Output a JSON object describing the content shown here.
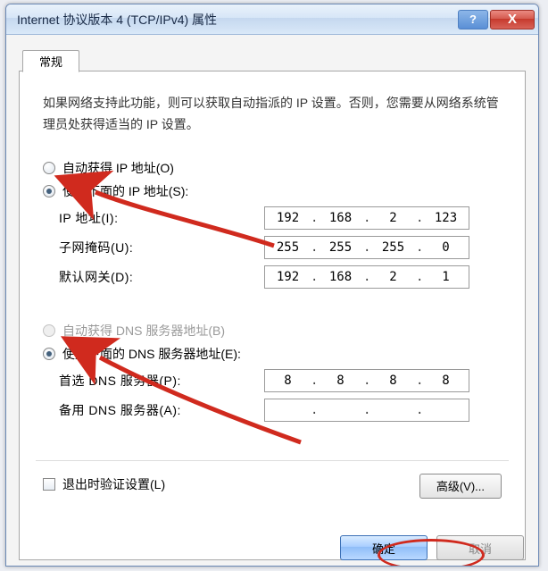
{
  "titlebar": {
    "title": "Internet 协议版本 4 (TCP/IPv4) 属性",
    "help": "?",
    "close": "X"
  },
  "tab_general": "常规",
  "description": "如果网络支持此功能，则可以获取自动指派的 IP 设置。否则，您需要从网络系统管理员处获得适当的 IP 设置。",
  "ip_section": {
    "auto_label": "自动获得 IP 地址(O)",
    "manual_label": "使用下面的 IP 地址(S):",
    "ip_label": "IP 地址(I):",
    "ip": [
      "192",
      "168",
      "2",
      "123"
    ],
    "mask_label": "子网掩码(U):",
    "mask": [
      "255",
      "255",
      "255",
      "0"
    ],
    "gw_label": "默认网关(D):",
    "gw": [
      "192",
      "168",
      "2",
      "1"
    ]
  },
  "dns_section": {
    "auto_label": "自动获得 DNS 服务器地址(B)",
    "manual_label": "使用下面的 DNS 服务器地址(E):",
    "pref_label": "首选 DNS 服务器(P):",
    "pref": [
      "8",
      "8",
      "8",
      "8"
    ],
    "alt_label": "备用 DNS 服务器(A):",
    "alt": [
      "",
      "",
      "",
      ""
    ]
  },
  "validate_label": "退出时验证设置(L)",
  "advanced_label": "高级(V)...",
  "ok_label": "确定",
  "cancel_label": "取消"
}
